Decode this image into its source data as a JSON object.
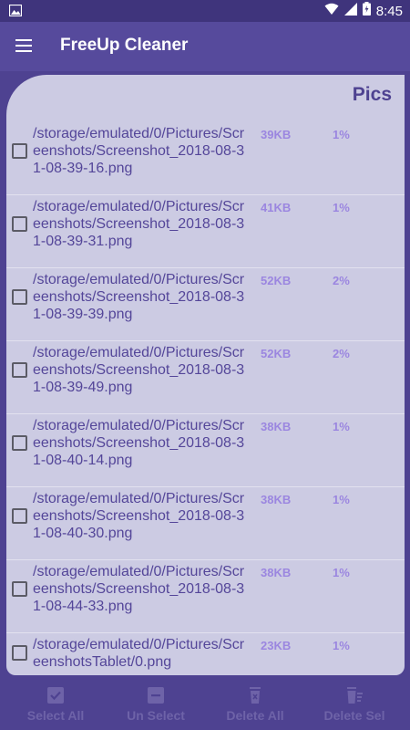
{
  "status": {
    "time": "8:45"
  },
  "app": {
    "title": "FreeUp Cleaner"
  },
  "card": {
    "title": "Pics"
  },
  "files": [
    {
      "path": "/storage/emulated/0/Pictures/Screenshots/Screenshot_2018-08-31-08-39-16.png",
      "size": "39KB",
      "percent": "1%",
      "checked": false
    },
    {
      "path": "/storage/emulated/0/Pictures/Screenshots/Screenshot_2018-08-31-08-39-31.png",
      "size": "41KB",
      "percent": "1%",
      "checked": false
    },
    {
      "path": "/storage/emulated/0/Pictures/Screenshots/Screenshot_2018-08-31-08-39-39.png",
      "size": "52KB",
      "percent": "2%",
      "checked": false
    },
    {
      "path": "/storage/emulated/0/Pictures/Screenshots/Screenshot_2018-08-31-08-39-49.png",
      "size": "52KB",
      "percent": "2%",
      "checked": false
    },
    {
      "path": "/storage/emulated/0/Pictures/Screenshots/Screenshot_2018-08-31-08-40-14.png",
      "size": "38KB",
      "percent": "1%",
      "checked": false
    },
    {
      "path": "/storage/emulated/0/Pictures/Screenshots/Screenshot_2018-08-31-08-40-30.png",
      "size": "38KB",
      "percent": "1%",
      "checked": false
    },
    {
      "path": "/storage/emulated/0/Pictures/Screenshots/Screenshot_2018-08-31-08-44-33.png",
      "size": "38KB",
      "percent": "1%",
      "checked": false
    },
    {
      "path": "/storage/emulated/0/Pictures/ScreenshotsTablet/0.png",
      "size": "23KB",
      "percent": "1%",
      "checked": false
    }
  ],
  "actions": {
    "select_all": "Select All",
    "unselect": "Un Select",
    "delete_all": "Delete All",
    "delete_selected": "Delete Sel"
  },
  "colors": {
    "background": "#4e4291",
    "card": "#cccbe3",
    "path_text": "#544699",
    "size_text": "#9b86e0"
  }
}
